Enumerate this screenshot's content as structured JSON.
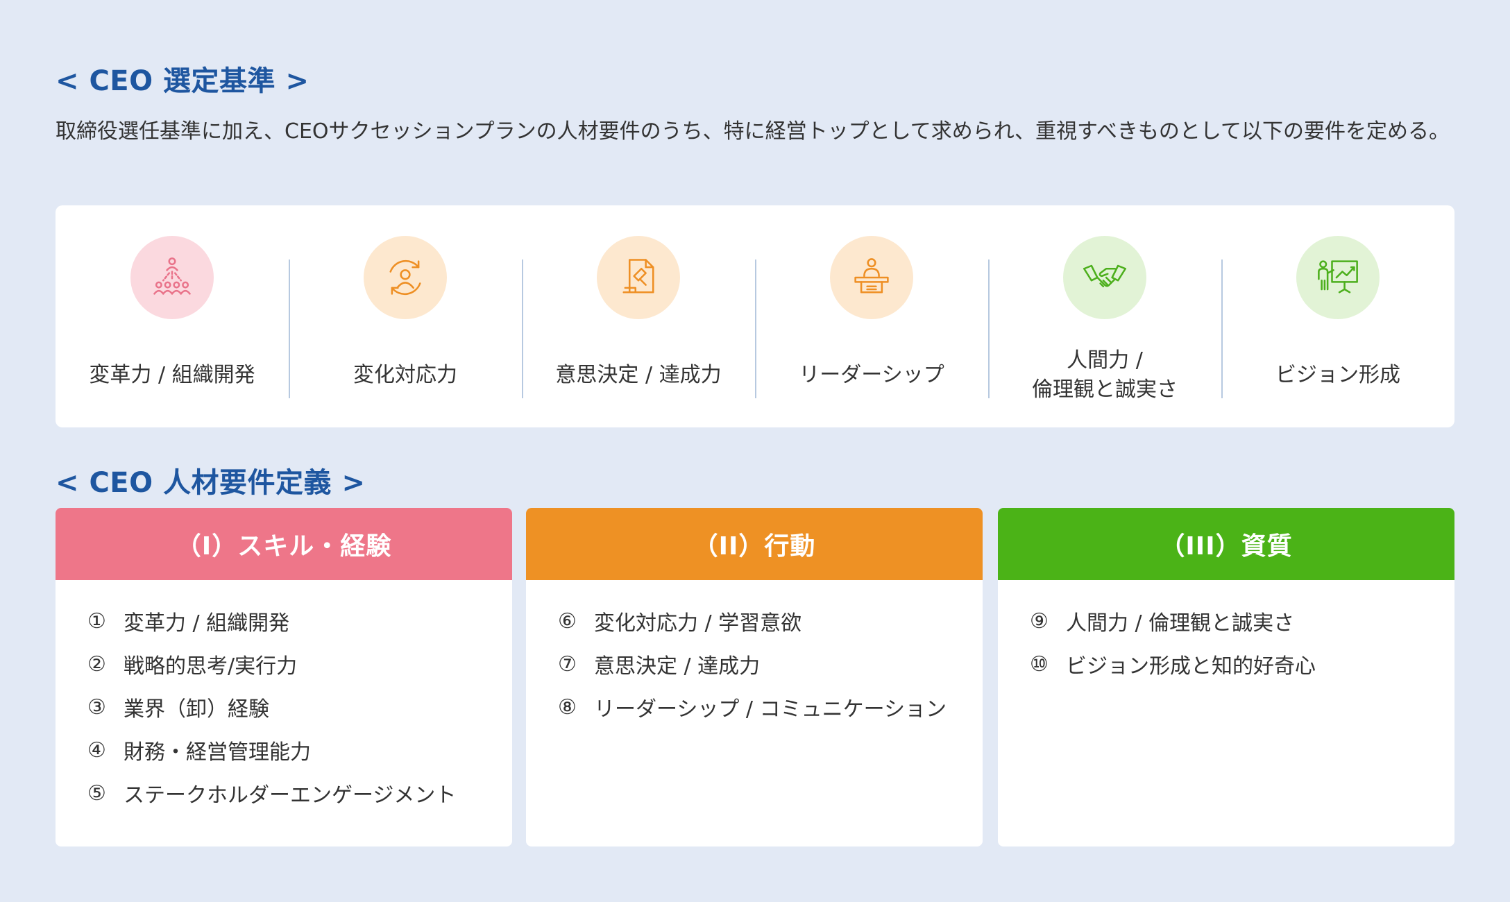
{
  "section1": {
    "title": "< CEO 選定基準 >",
    "description": "取締役選任基準に加え、CEOサクセッションプランの人材要件のうち、特に経営トップとして求められ、重視すべきものとして以下の要件を定める。",
    "criteria": [
      {
        "label": "変革力 / 組織開発",
        "icon": "organization-hierarchy-icon",
        "circle_color": "#fbd9df",
        "icon_color": "#e9738a"
      },
      {
        "label": "変化対応力",
        "icon": "person-cycle-icon",
        "circle_color": "#fde8cf",
        "icon_color": "#ee8f24"
      },
      {
        "label": "意思決定 / 達成力",
        "icon": "gavel-document-icon",
        "circle_color": "#fde8cf",
        "icon_color": "#ee8f24"
      },
      {
        "label": "リーダーシップ",
        "icon": "speaker-podium-icon",
        "circle_color": "#fde8cf",
        "icon_color": "#ee8f24"
      },
      {
        "label": "人間力 /\n倫理観と誠実さ",
        "icon": "handshake-icon",
        "circle_color": "#e2f3d6",
        "icon_color": "#4caf1c"
      },
      {
        "label": "ビジョン形成",
        "icon": "presentation-chart-icon",
        "circle_color": "#e2f3d6",
        "icon_color": "#4caf1c"
      }
    ]
  },
  "section2": {
    "title": "< CEO 人材要件定義 >",
    "cards": [
      {
        "header": "（I）スキル・経験",
        "color": "#ee7689",
        "items": [
          {
            "num": "①",
            "text": "変革力 / 組織開発"
          },
          {
            "num": "②",
            "text": "戦略的思考/実行力"
          },
          {
            "num": "③",
            "text": "業界（卸）経験"
          },
          {
            "num": "④",
            "text": "財務・経営管理能力"
          },
          {
            "num": "⑤",
            "text": "ステークホルダーエンゲージメント"
          }
        ]
      },
      {
        "header": "（II）行動",
        "color": "#ee9124",
        "items": [
          {
            "num": "⑥",
            "text": "変化対応力 / 学習意欲"
          },
          {
            "num": "⑦",
            "text": "意思決定 / 達成力"
          },
          {
            "num": "⑧",
            "text": "リーダーシップ / コミュニケーション"
          }
        ]
      },
      {
        "header": "（III）資質",
        "color": "#4bb317",
        "items": [
          {
            "num": "⑨",
            "text": "人間力 / 倫理観と誠実さ"
          },
          {
            "num": "⑩",
            "text": "ビジョン形成と知的好奇心"
          }
        ]
      }
    ]
  }
}
